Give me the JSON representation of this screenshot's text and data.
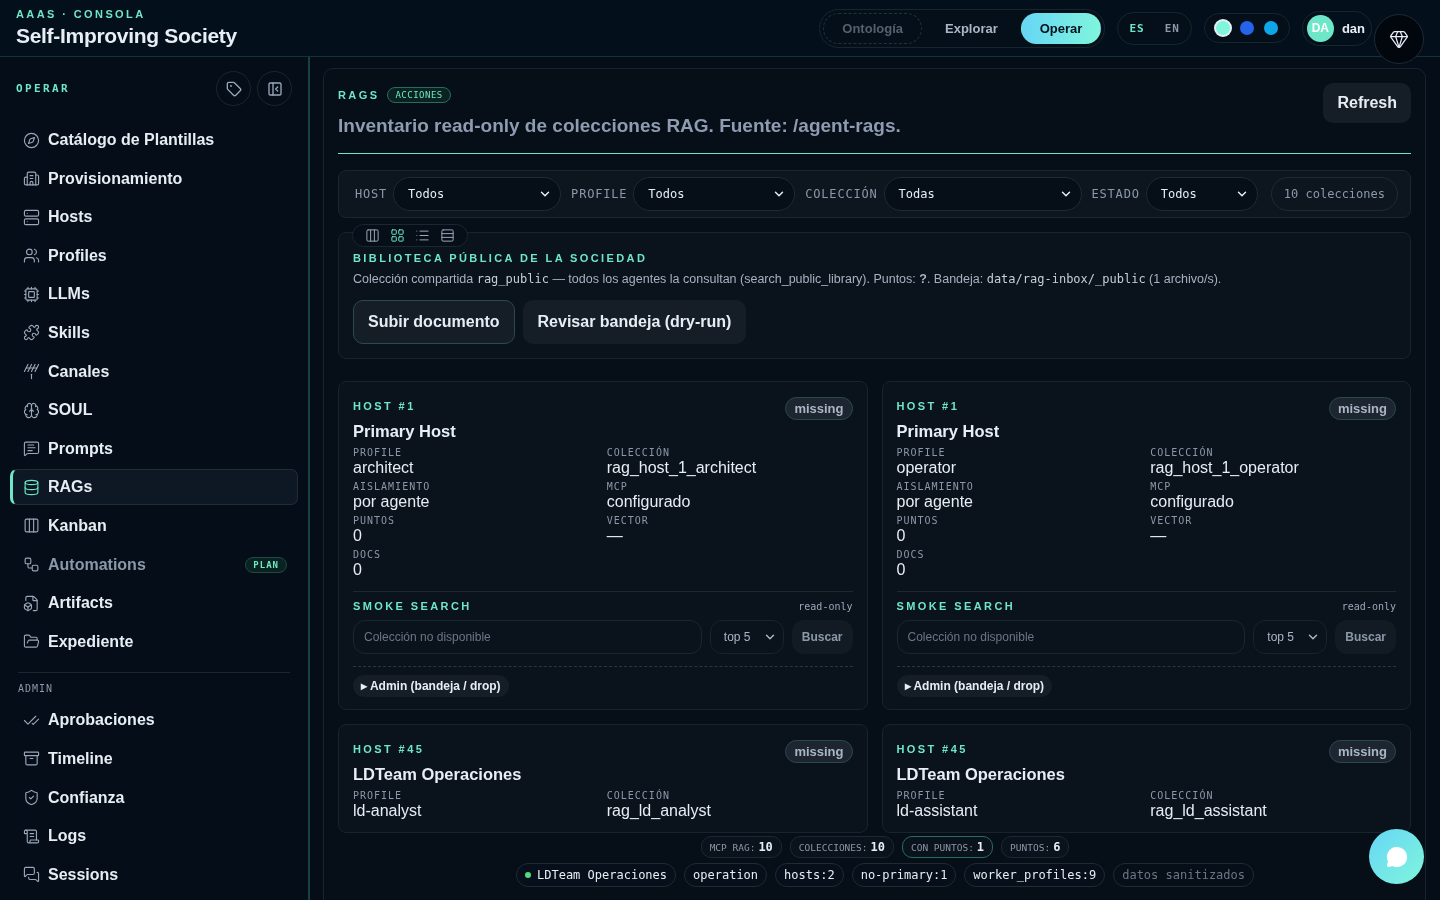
{
  "header": {
    "eyebrow": "AAAS · CONSOLA",
    "title": "Self-Improving Society"
  },
  "nav_tabs": [
    {
      "label": "Ontología",
      "selected": false,
      "disabled": true
    },
    {
      "label": "Explorar",
      "selected": false,
      "disabled": false
    },
    {
      "label": "Operar",
      "selected": true,
      "disabled": false
    }
  ],
  "languages": [
    {
      "label": "ES",
      "selected": true
    },
    {
      "label": "EN",
      "selected": false
    }
  ],
  "theme_swatches": [
    {
      "color": "#7ff5dc",
      "selected": true
    },
    {
      "color": "#2563eb",
      "selected": false
    },
    {
      "color": "#0ea5e9",
      "selected": false
    }
  ],
  "user": {
    "initials": "DA",
    "name": "dan"
  },
  "sidebar": {
    "section_label": "OPERAR",
    "items": [
      {
        "label": "Catálogo de Plantillas",
        "selected": false,
        "muted": false
      },
      {
        "label": "Provisionamiento",
        "selected": false,
        "muted": false
      },
      {
        "label": "Hosts",
        "selected": false,
        "muted": false
      },
      {
        "label": "Profiles",
        "selected": false,
        "muted": false
      },
      {
        "label": "LLMs",
        "selected": false,
        "muted": false
      },
      {
        "label": "Skills",
        "selected": false,
        "muted": false
      },
      {
        "label": "Canales",
        "selected": false,
        "muted": false
      },
      {
        "label": "SOUL",
        "selected": false,
        "muted": false
      },
      {
        "label": "Prompts",
        "selected": false,
        "muted": false
      },
      {
        "label": "RAGs",
        "selected": true,
        "muted": false
      },
      {
        "label": "Kanban",
        "selected": false,
        "muted": false
      },
      {
        "label": "Automations",
        "selected": false,
        "muted": true,
        "badge": "PLAN"
      },
      {
        "label": "Artifacts",
        "selected": false,
        "muted": false
      },
      {
        "label": "Expediente",
        "selected": false,
        "muted": false
      }
    ],
    "admin_label": "ADMIN",
    "admin_items": [
      {
        "label": "Aprobaciones",
        "selected": false
      },
      {
        "label": "Timeline",
        "selected": false
      },
      {
        "label": "Confianza",
        "selected": false
      },
      {
        "label": "Logs",
        "selected": false
      },
      {
        "label": "Sessions",
        "selected": false
      }
    ]
  },
  "page": {
    "eyebrow": "RAGS",
    "badge": "ACCIONES",
    "description": "Inventario read-only de colecciones RAG. Fuente: /agent-rags.",
    "refresh_button": "Refresh"
  },
  "filters": [
    {
      "label": "HOST",
      "value": "Todos"
    },
    {
      "label": "PROFILE",
      "value": "Todos"
    },
    {
      "label": "COLECCIÓN",
      "value": "Todas"
    },
    {
      "label": "ESTADO",
      "value": "Todos"
    }
  ],
  "collection_count": "10 colecciones",
  "view_modes": [
    {
      "selected": false
    },
    {
      "selected": true
    },
    {
      "selected": false
    },
    {
      "selected": false
    }
  ],
  "library": {
    "title": "BIBLIOTECA PÚBLICA DE LA SOCIEDAD",
    "description": [
      {
        "kind": "text",
        "text": "Colección compartida "
      },
      {
        "kind": "code",
        "text": "rag_public"
      },
      {
        "kind": "text",
        "text": " — todos los agentes la consultan (search_public_library). Puntos: **?**. Bandeja: "
      },
      {
        "kind": "code",
        "text": "data/rag-inbox/_public"
      },
      {
        "kind": "text",
        "text": " (1 archivo/s)."
      }
    ],
    "buttons": [
      {
        "label": "Subir documento",
        "primary": true
      },
      {
        "label": "Revisar bandeja (dry-run)",
        "primary": false
      }
    ]
  },
  "cards": [
    {
      "host": "HOST #1",
      "name": "Primary Host",
      "status": "missing",
      "fields": [
        {
          "label": "PROFILE",
          "value": "architect"
        },
        {
          "label": "COLECCIÓN",
          "value": "rag_host_1_architect"
        },
        {
          "label": "AISLAMIENTO",
          "value": "por agente"
        },
        {
          "label": "MCP",
          "value": "configurado"
        },
        {
          "label": "PUNTOS",
          "value": "0"
        },
        {
          "label": "VECTOR",
          "value": "—"
        },
        {
          "label": "DOCS",
          "value": "0"
        }
      ],
      "smoke": {
        "title": "SMOKE SEARCH",
        "note": "read-only",
        "placeholder": "Colección no disponible",
        "top": "top 5",
        "button": "Buscar"
      },
      "admin_toggle": "▸ Admin (bandeja / drop)"
    },
    {
      "host": "HOST #1",
      "name": "Primary Host",
      "status": "missing",
      "fields": [
        {
          "label": "PROFILE",
          "value": "operator"
        },
        {
          "label": "COLECCIÓN",
          "value": "rag_host_1_operator"
        },
        {
          "label": "AISLAMIENTO",
          "value": "por agente"
        },
        {
          "label": "MCP",
          "value": "configurado"
        },
        {
          "label": "PUNTOS",
          "value": "0"
        },
        {
          "label": "VECTOR",
          "value": "—"
        },
        {
          "label": "DOCS",
          "value": "0"
        }
      ],
      "smoke": {
        "title": "SMOKE SEARCH",
        "note": "read-only",
        "placeholder": "Colección no disponible",
        "top": "top 5",
        "button": "Buscar"
      },
      "admin_toggle": "▸ Admin (bandeja / drop)"
    },
    {
      "host": "HOST #45",
      "name": "LDTeam Operaciones",
      "status": "missing",
      "fields": [
        {
          "label": "PROFILE",
          "value": "ld-analyst"
        },
        {
          "label": "COLECCIÓN",
          "value": "rag_ld_analyst"
        }
      ]
    },
    {
      "host": "HOST #45",
      "name": "LDTeam Operaciones",
      "status": "missing",
      "fields": [
        {
          "label": "PROFILE",
          "value": "ld-assistant"
        },
        {
          "label": "COLECCIÓN",
          "value": "rag_ld_assistant"
        }
      ]
    }
  ],
  "overlay": {
    "stats": [
      {
        "label": "MCP RAG:",
        "value": "10",
        "highlighted": false
      },
      {
        "label": "COLECCIONES:",
        "value": "10",
        "highlighted": false
      },
      {
        "label": "CON PUNTOS:",
        "value": "1",
        "highlighted": true
      },
      {
        "label": "PUNTOS:",
        "value": "6",
        "highlighted": false
      }
    ],
    "chips": [
      {
        "text": "LDTeam Operaciones",
        "kind": "status"
      },
      {
        "text": "operation",
        "kind": "plain"
      },
      {
        "text": "hosts:2",
        "kind": "plain"
      },
      {
        "text": "no-primary:1",
        "kind": "plain"
      },
      {
        "text": "worker_profiles:9",
        "kind": "plain"
      },
      {
        "text": "datos sanitizados",
        "kind": "muted"
      }
    ]
  }
}
